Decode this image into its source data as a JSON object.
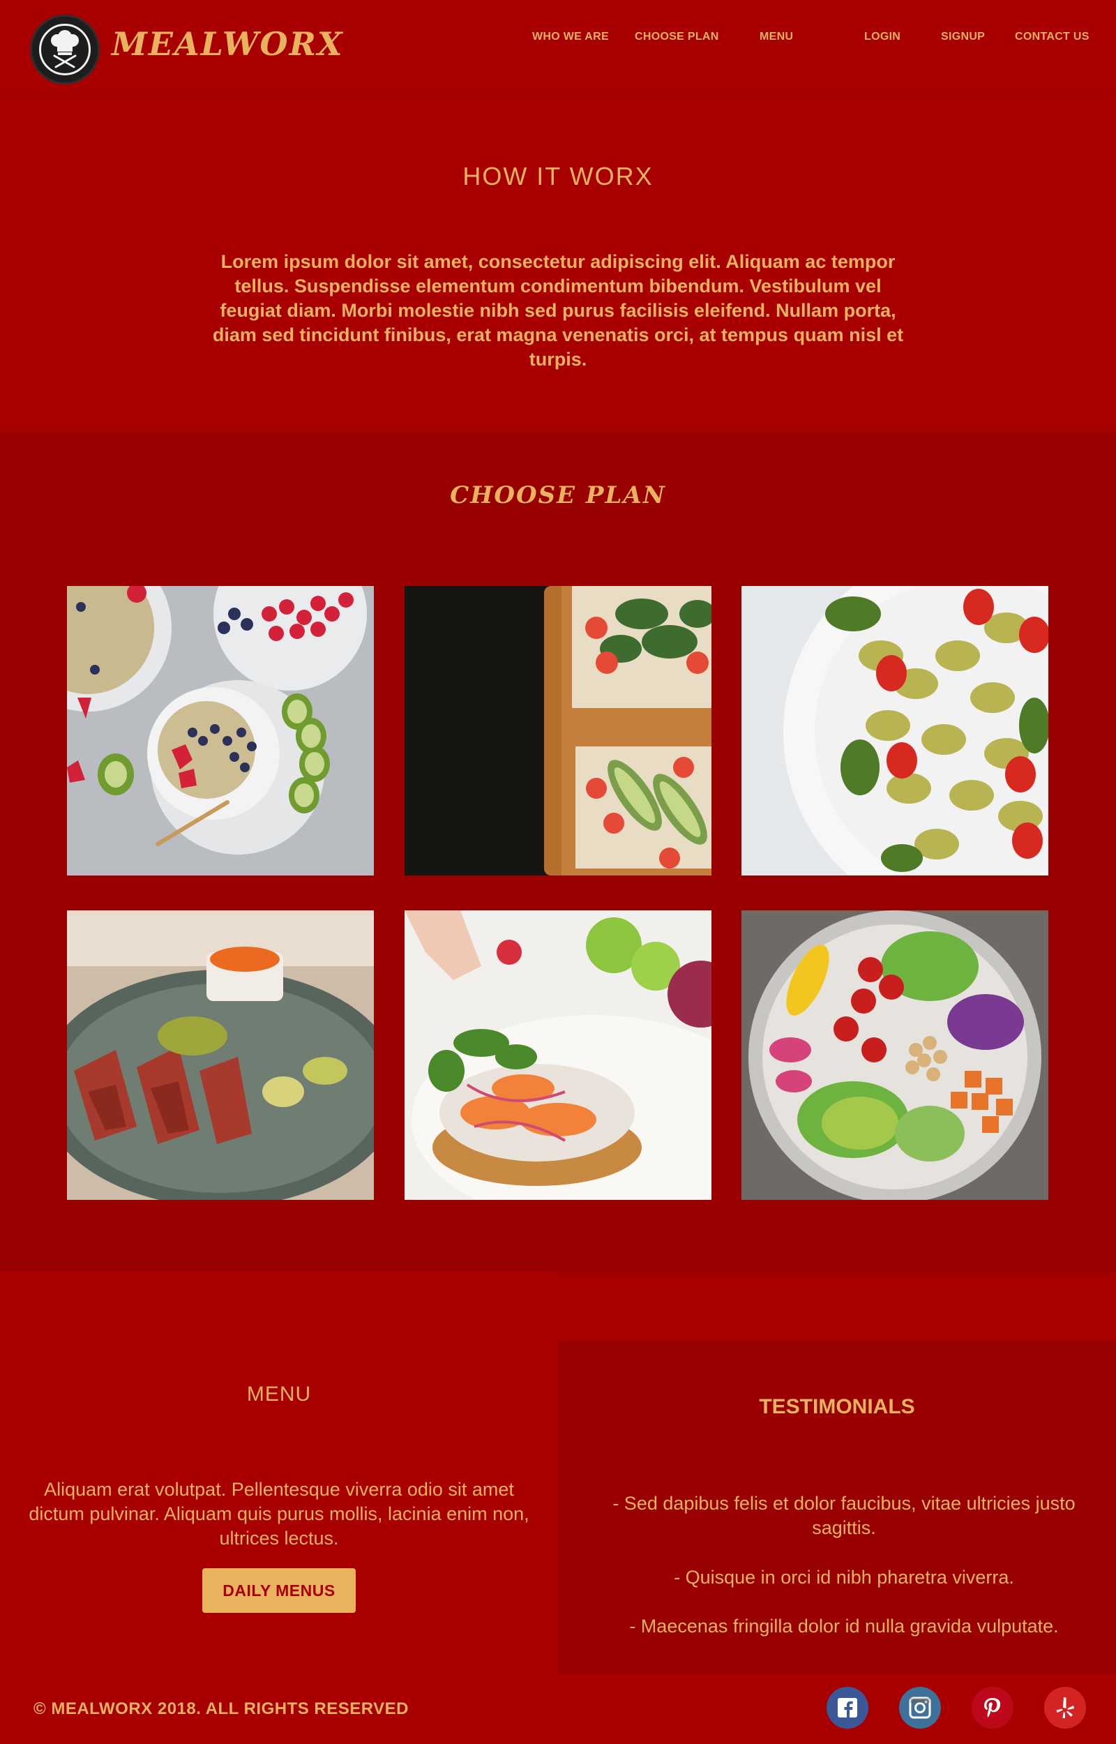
{
  "brand": {
    "name": "MEALWORX"
  },
  "nav": {
    "items": [
      "WHO WE ARE",
      "CHOOSE PLAN",
      "MENU",
      "LOGIN",
      "SIGNUP",
      "CONTACT US"
    ]
  },
  "how": {
    "title": "HOW IT WORX",
    "body": "Lorem ipsum dolor sit amet, consectetur adipiscing elit. Aliquam ac tempor tellus. Suspendisse elementum condimentum bibendum. Vestibulum vel feugiat diam. Morbi molestie nibh sed purus facilisis eleifend. Nullam porta, diam sed tincidunt finibus, erat magna venenatis orci, at tempus quam nisl et turpis."
  },
  "plans": {
    "title": "CHOOSE PLAN",
    "tiles": [
      {
        "icon": "oatmeal-berries-photo"
      },
      {
        "icon": "avocado-toast-photo"
      },
      {
        "icon": "pasta-salad-photo"
      },
      {
        "icon": "seared-tuna-photo"
      },
      {
        "icon": "salmon-tostada-photo"
      },
      {
        "icon": "buddha-bowl-photo"
      }
    ]
  },
  "menu": {
    "title": "MENU",
    "body": "Aliquam erat volutpat. Pellentesque viverra odio sit amet dictum pulvinar. Aliquam quis purus mollis, lacinia enim non, ultrices lectus.",
    "button": "DAILY MENUS"
  },
  "testimonials": {
    "title": "TESTIMONIALS",
    "quotes": [
      "- Sed dapibus felis et dolor faucibus, vitae ultricies justo sagittis.",
      "- Quisque in orci id nibh pharetra viverra.",
      "- Maecenas fringilla dolor id nulla gravida vulputate."
    ]
  },
  "footer": {
    "copyright": "© MEALWORX 2018. ALL RIGHTS RESERVED",
    "social": [
      "facebook-icon",
      "instagram-icon",
      "pinterest-icon",
      "yelp-icon"
    ]
  },
  "colors": {
    "background": "#a80000",
    "section_dark": "#990000",
    "accent": "#e9b25f"
  }
}
